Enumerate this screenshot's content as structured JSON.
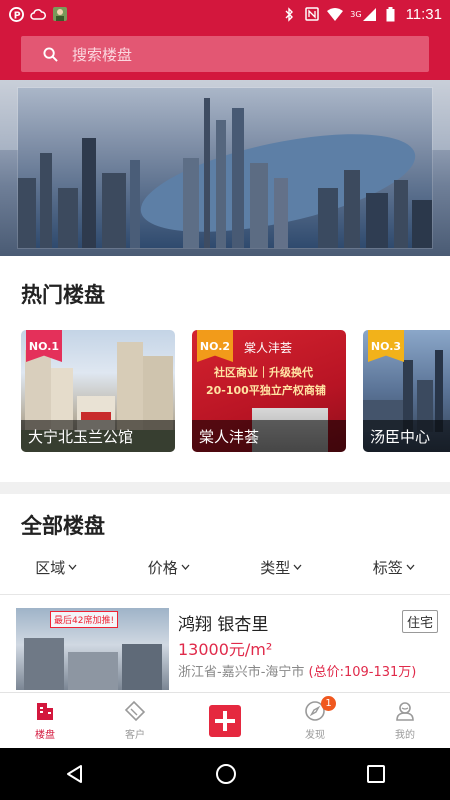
{
  "status_bar": {
    "network": "3G",
    "time": "11:31"
  },
  "search": {
    "placeholder": "搜索楼盘"
  },
  "hot_section": {
    "title": "热门楼盘",
    "cards": [
      {
        "rank": "NO.1",
        "name": "大宁北玉兰公馆",
        "badge_color": "#e4305a"
      },
      {
        "rank": "NO.2",
        "name": "棠人沣荟",
        "badge_color": "#f29b1a"
      },
      {
        "rank": "NO.3",
        "name": "汤臣中心",
        "badge_color": "#f2b21a"
      }
    ],
    "card2_ad_lines": [
      "棠人沣荟",
      "社区商业｜升级换代",
      "20-100平独立产权商铺"
    ]
  },
  "all_section": {
    "title": "全部楼盘",
    "filters": [
      "区域",
      "价格",
      "类型",
      "标签"
    ]
  },
  "listing": {
    "name": "鸿翔 银杏里",
    "price": "13000元/m²",
    "location": "浙江省-嘉兴市-海宁市",
    "total_price": "(总价:109-131万)",
    "type_tag": "住宅",
    "image_banner": "最后42席加推!"
  },
  "tabbar": {
    "items": [
      {
        "label": "楼盘",
        "icon": "building-icon"
      },
      {
        "label": "客户",
        "icon": "handshake-icon"
      },
      {
        "label": "",
        "icon": "add-plus-icon"
      },
      {
        "label": "发现",
        "icon": "compass-icon",
        "badge": "1"
      },
      {
        "label": "我的",
        "icon": "user-icon"
      }
    ]
  },
  "colors": {
    "brand": "#d3173d",
    "price": "#e02a4a",
    "badge": "#f0581f"
  }
}
